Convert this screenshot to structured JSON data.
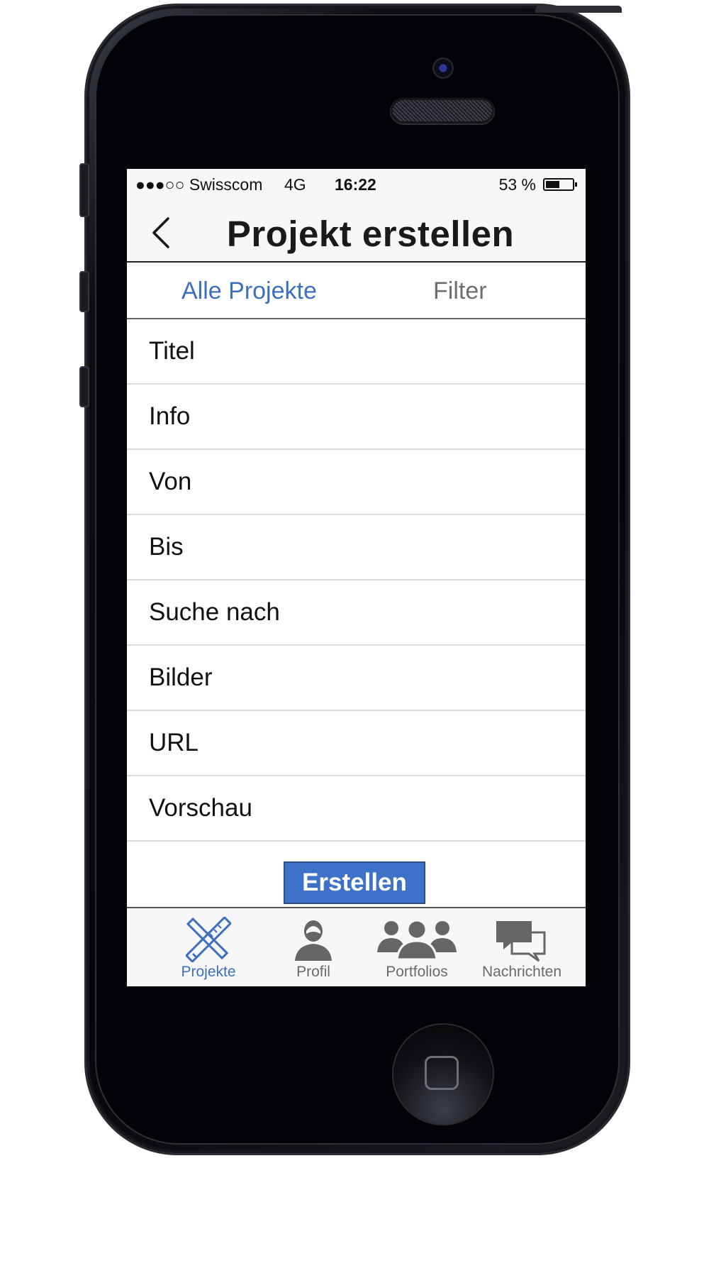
{
  "statusbar": {
    "carrier": "●●●○○ Swisscom",
    "network": "4G",
    "time": "16:22",
    "battery_text": "53 %",
    "battery_level": 0.53
  },
  "navbar": {
    "back_icon": "chevron-left-icon",
    "title": "Projekt erstellen"
  },
  "segment": {
    "items": [
      {
        "label": "Alle Projekte",
        "active": true
      },
      {
        "label": "Filter",
        "active": false
      }
    ]
  },
  "form": {
    "fields": [
      {
        "label": "Titel"
      },
      {
        "label": "Info"
      },
      {
        "label": "Von"
      },
      {
        "label": "Bis"
      },
      {
        "label": "Suche nach"
      },
      {
        "label": "Bilder"
      },
      {
        "label": "URL"
      },
      {
        "label": "Vorschau"
      }
    ],
    "submit_label": "Erstellen"
  },
  "tabbar": {
    "items": [
      {
        "label": "Projekte",
        "icon": "pencil-ruler-icon",
        "active": true
      },
      {
        "label": "Profil",
        "icon": "person-icon",
        "active": false
      },
      {
        "label": "Portfolios",
        "icon": "group-icon",
        "active": false
      },
      {
        "label": "Nachrichten",
        "icon": "chat-bubbles-icon",
        "active": false
      }
    ]
  },
  "colors": {
    "accent": "#3d6fc0",
    "button": "#3d72c8",
    "inactive": "#6e6e6e"
  }
}
